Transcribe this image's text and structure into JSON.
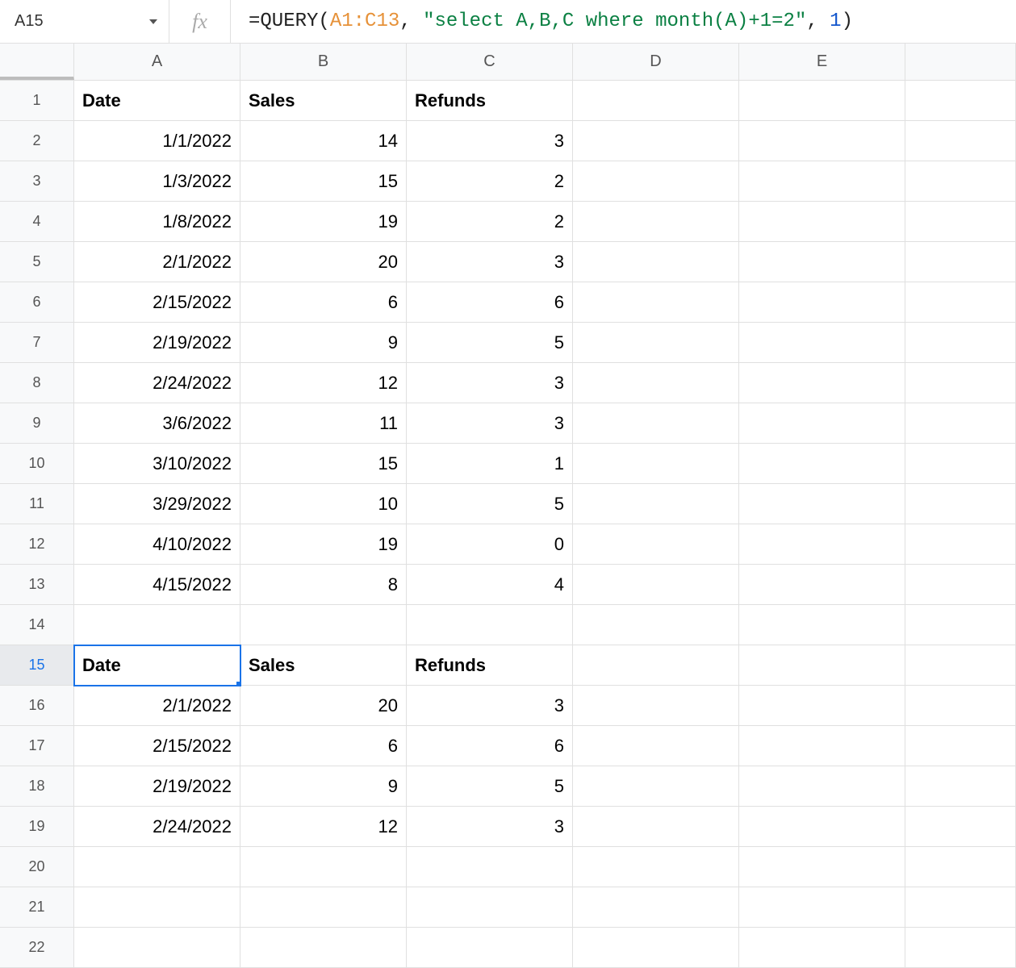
{
  "name_box": "A15",
  "fx_label": "fx",
  "formula": {
    "eq": "=",
    "fn": "QUERY",
    "open": "(",
    "range": "A1:C13",
    "comma1": ", ",
    "str": "\"select A,B,C where month(A)+1=2\"",
    "comma2": ", ",
    "num": "1",
    "close": ")"
  },
  "columns": [
    "A",
    "B",
    "C",
    "D",
    "E"
  ],
  "rows": [
    "1",
    "2",
    "3",
    "4",
    "5",
    "6",
    "7",
    "8",
    "9",
    "10",
    "11",
    "12",
    "13",
    "14",
    "15",
    "16",
    "17",
    "18",
    "19",
    "20",
    "21",
    "22"
  ],
  "selected_cell": "A15",
  "selected_row": "15",
  "data": {
    "r1": {
      "A": "Date",
      "B": "Sales",
      "C": "Refunds"
    },
    "r2": {
      "A": "1/1/2022",
      "B": "14",
      "C": "3"
    },
    "r3": {
      "A": "1/3/2022",
      "B": "15",
      "C": "2"
    },
    "r4": {
      "A": "1/8/2022",
      "B": "19",
      "C": "2"
    },
    "r5": {
      "A": "2/1/2022",
      "B": "20",
      "C": "3"
    },
    "r6": {
      "A": "2/15/2022",
      "B": "6",
      "C": "6"
    },
    "r7": {
      "A": "2/19/2022",
      "B": "9",
      "C": "5"
    },
    "r8": {
      "A": "2/24/2022",
      "B": "12",
      "C": "3"
    },
    "r9": {
      "A": "3/6/2022",
      "B": "11",
      "C": "3"
    },
    "r10": {
      "A": "3/10/2022",
      "B": "15",
      "C": "1"
    },
    "r11": {
      "A": "3/29/2022",
      "B": "10",
      "C": "5"
    },
    "r12": {
      "A": "4/10/2022",
      "B": "19",
      "C": "0"
    },
    "r13": {
      "A": "4/15/2022",
      "B": "8",
      "C": "4"
    },
    "r14": {
      "A": "",
      "B": "",
      "C": ""
    },
    "r15": {
      "A": "Date",
      "B": "Sales",
      "C": "Refunds"
    },
    "r16": {
      "A": "2/1/2022",
      "B": "20",
      "C": "3"
    },
    "r17": {
      "A": "2/15/2022",
      "B": "6",
      "C": "6"
    },
    "r18": {
      "A": "2/19/2022",
      "B": "9",
      "C": "5"
    },
    "r19": {
      "A": "2/24/2022",
      "B": "12",
      "C": "3"
    },
    "r20": {
      "A": "",
      "B": "",
      "C": ""
    },
    "r21": {
      "A": "",
      "B": "",
      "C": ""
    },
    "r22": {
      "A": "",
      "B": "",
      "C": ""
    }
  }
}
